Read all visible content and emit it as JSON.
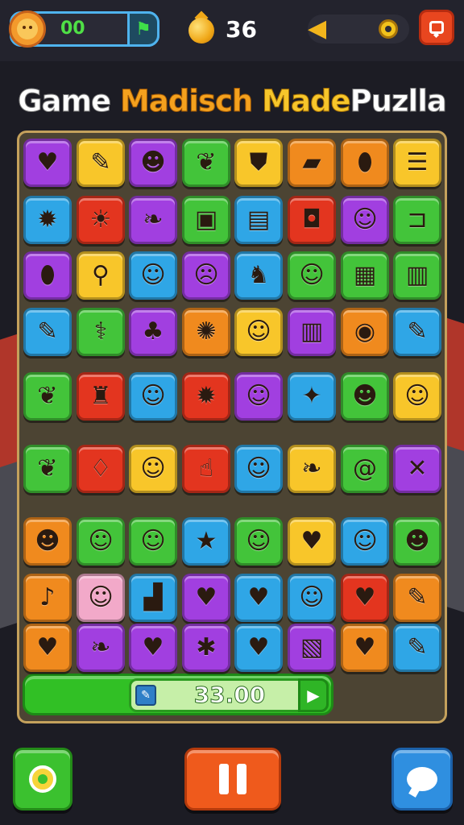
{
  "hud": {
    "score": "00",
    "coins": "36",
    "avatar_icon": "character-face-icon",
    "flag_icon": "flag-icon",
    "coin_icon": "coin-drop-icon",
    "hint_icon": "speaker-arrow-icon",
    "menu_icon": "chat-menu-icon"
  },
  "title": {
    "w1": "Game",
    "w2": "Madisch",
    "w3": "Made",
    "w4": "Puzlla"
  },
  "colors": {
    "green": "#43c43a",
    "purple": "#a13fe0",
    "orange": "#f08a1e",
    "blue": "#2fa6e6",
    "red": "#e3351f",
    "yellow": "#f8c62a",
    "pink": "#f2a9c9"
  },
  "board": {
    "rows": [
      [
        [
          "purple",
          "♥",
          "heart-icon"
        ],
        [
          "yellow",
          "✎",
          "toothpaste-icon"
        ],
        [
          "purple",
          "☻",
          "blob-icon"
        ],
        [
          "green",
          "❦",
          "leaf-icon"
        ],
        [
          "yellow",
          "⛊",
          "shield-icon"
        ],
        [
          "orange",
          "▰",
          "eraser-icon"
        ],
        [
          "orange",
          "⬮",
          "balloon-icon"
        ],
        [
          "yellow",
          "☰",
          "notepad-icon"
        ]
      ],
      [
        [
          "blue",
          "✹",
          "sun-icon"
        ],
        [
          "red",
          "☀",
          "sun-icon"
        ],
        [
          "purple",
          "❧",
          "leaf-icon"
        ],
        [
          "green",
          "▣",
          "picture-icon"
        ],
        [
          "blue",
          "▤",
          "tablet-icon"
        ],
        [
          "red",
          "◘",
          "scroll-icon"
        ],
        [
          "purple",
          "☺",
          "smiley-icon"
        ],
        [
          "green",
          "⊐",
          "wall-icon"
        ]
      ],
      [
        [
          "purple",
          "⬮",
          "balloon-icon"
        ],
        [
          "yellow",
          "⚲",
          "lollipop-icon"
        ],
        [
          "blue",
          "☺",
          "smiley-icon"
        ],
        [
          "purple",
          "☹",
          "cat-face-icon"
        ],
        [
          "blue",
          "♞",
          "pony-icon"
        ],
        [
          "green",
          "☺",
          "critter-icon"
        ],
        [
          "green",
          "▦",
          "board-icon"
        ],
        [
          "green",
          "▥",
          "panel-icon"
        ]
      ],
      [
        [
          "blue",
          "✎",
          "pencil-icon"
        ],
        [
          "green",
          "⚕",
          "branch-icon"
        ],
        [
          "purple",
          "♣",
          "clover-icon"
        ],
        [
          "orange",
          "✺",
          "gear-sun-icon"
        ],
        [
          "yellow",
          "☺",
          "smiley-icon"
        ],
        [
          "purple",
          "▥",
          "backpack-icon"
        ],
        [
          "orange",
          "◉",
          "donut-icon"
        ],
        [
          "blue",
          "✎",
          "pencil-icon"
        ]
      ],
      [
        [
          "green",
          "❦",
          "leaf-icon"
        ],
        [
          "red",
          "♜",
          "bottle-icon"
        ],
        [
          "blue",
          "☺",
          "character-icon"
        ],
        [
          "red",
          "✹",
          "sun-face-icon"
        ],
        [
          "purple",
          "☺",
          "character-icon"
        ],
        [
          "blue",
          "✦",
          "brush-icon"
        ],
        [
          "green",
          "☻",
          "elf-icon"
        ],
        [
          "yellow",
          "☺",
          "pink-ball-icon"
        ]
      ],
      [
        [
          "green",
          "❦",
          "leaf-icon"
        ],
        [
          "red",
          "♢",
          "dice-icon"
        ],
        [
          "yellow",
          "☺",
          "fox-icon"
        ],
        [
          "red",
          "☝",
          "hand-icon"
        ],
        [
          "blue",
          "☺",
          "character-icon"
        ],
        [
          "yellow",
          "❧",
          "leaf-icon"
        ],
        [
          "green",
          "@",
          "spiral-icon"
        ],
        [
          "purple",
          "✕",
          "cross-icon"
        ]
      ],
      [
        [
          "orange",
          "☻",
          "blob-icon"
        ],
        [
          "green",
          "☺",
          "face-icon"
        ],
        [
          "green",
          "☺",
          "girl-icon"
        ],
        [
          "blue",
          "★",
          "star-icon"
        ],
        [
          "green",
          "☺",
          "goblin-icon"
        ],
        [
          "yellow",
          "♥",
          "bag-icon"
        ],
        [
          "blue",
          "☺",
          "bear-icon"
        ],
        [
          "green",
          "☻",
          "monster-icon"
        ]
      ],
      [
        [
          "orange",
          "♪",
          "bell-icon"
        ],
        [
          "pink",
          "☺",
          "pig-icon"
        ],
        [
          "blue",
          "▟",
          "chart-icon"
        ],
        [
          "purple",
          "♥",
          "heart-icon"
        ],
        [
          "blue",
          "♥",
          "heart-icon"
        ],
        [
          "blue",
          "☺",
          "hedgehog-icon"
        ],
        [
          "red",
          "♥",
          "glove-icon"
        ],
        [
          "orange",
          "✎",
          "brush-icon"
        ]
      ],
      [
        [
          "orange",
          "♥",
          "heart-icon"
        ],
        [
          "purple",
          "❧",
          "leaf-icon"
        ],
        [
          "purple",
          "♥",
          "heart-icon"
        ],
        [
          "purple",
          "✱",
          "cookie-icon"
        ],
        [
          "blue",
          "♥",
          "heart-icon"
        ],
        [
          "purple",
          "▧",
          "box-icon"
        ],
        [
          "orange",
          "♥",
          "heart-icon"
        ],
        [
          "blue",
          "✎",
          "marker-icon"
        ]
      ]
    ]
  },
  "progress": {
    "value": "33.00",
    "mini_icon": "pencil-icon",
    "play_icon": "play-icon"
  },
  "controls": {
    "settings_icon": "gear-icon",
    "pause_icon": "pause-icon",
    "chat_icon": "chat-bubble-icon"
  }
}
